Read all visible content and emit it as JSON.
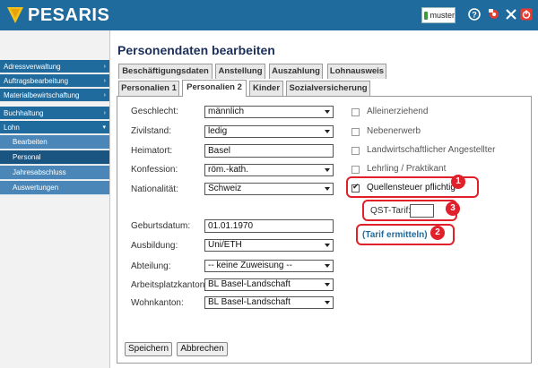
{
  "header": {
    "brand": "PESARIS",
    "user": "muster"
  },
  "sidebar": {
    "items": [
      {
        "label": "Adressverwaltung",
        "arrow": "›"
      },
      {
        "label": "Auftragsbearbeitung",
        "arrow": "›"
      },
      {
        "label": "Materialbewirtschaftung",
        "arrow": "›"
      },
      {
        "label": "Buchhaltung",
        "arrow": "›"
      },
      {
        "label": "Lohn",
        "arrow": "▾"
      }
    ],
    "sub_items": [
      {
        "label": "Bearbeiten"
      },
      {
        "label": "Personal"
      },
      {
        "label": "Jahresabschluss"
      },
      {
        "label": "Auswertungen"
      }
    ]
  },
  "page": {
    "title": "Personendaten bearbeiten"
  },
  "tabs_row1": [
    {
      "label": "Beschäftigungsdaten"
    },
    {
      "label": "Anstellung"
    },
    {
      "label": "Auszahlung"
    },
    {
      "label": "Lohnausweis"
    }
  ],
  "tabs_row2": [
    {
      "label": "Personalien 1"
    },
    {
      "label": "Personalien 2"
    },
    {
      "label": "Kinder"
    },
    {
      "label": "Sozialversicherung"
    }
  ],
  "form": {
    "geschlecht": {
      "label": "Geschlecht:",
      "value": "männlich"
    },
    "zivilstand": {
      "label": "Zivilstand:",
      "value": "ledig"
    },
    "heimatort": {
      "label": "Heimatort:",
      "value": "Basel"
    },
    "konfession": {
      "label": "Konfession:",
      "value": "röm.-kath."
    },
    "nationalitaet": {
      "label": "Nationalität:",
      "value": "Schweiz"
    },
    "geburtsdatum": {
      "label": "Geburtsdatum:",
      "value": "01.01.1970"
    },
    "ausbildung": {
      "label": "Ausbildung:",
      "value": "Uni/ETH"
    },
    "abteilung": {
      "label": "Abteilung:",
      "value": "-- keine Zuweisung --"
    },
    "arbeitsplatzkanton": {
      "label": "Arbeitsplatzkanton:",
      "value": "BL Basel-Landschaft"
    },
    "wohnkanton": {
      "label": "Wohnkanton:",
      "value": "BL Basel-Landschaft"
    }
  },
  "checkboxes": [
    {
      "label": "Alleinerziehend",
      "checked": false
    },
    {
      "label": "Nebenerwerb",
      "checked": false
    },
    {
      "label": "Landwirtschaftlicher Angestellter",
      "checked": false
    },
    {
      "label": "Lehrling / Praktikant",
      "checked": false
    },
    {
      "label": "Quellensteuer pflichtig",
      "checked": true
    }
  ],
  "qst": {
    "label": "QST-Tarif:",
    "value": "",
    "link": "(Tarif ermitteln)"
  },
  "badges": [
    "1",
    "2",
    "3"
  ],
  "buttons": {
    "save": "Speichern",
    "cancel": "Abbrechen"
  },
  "colors": {
    "header": "#1f6b9e",
    "callout": "#e0202a",
    "link": "#1f6b9e"
  }
}
